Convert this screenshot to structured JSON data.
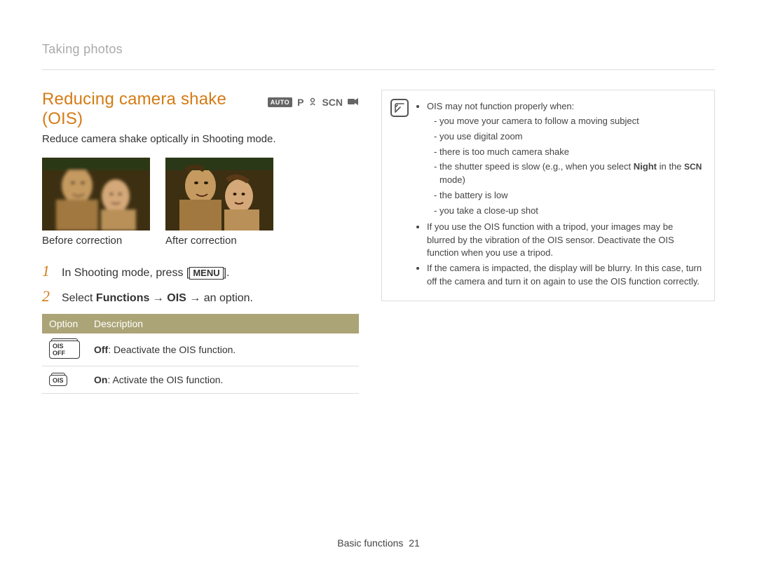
{
  "breadcrumb": "Taking photos",
  "heading": "Reducing camera shake (OIS)",
  "modes": {
    "auto": "AUTO",
    "p": "P",
    "scn": "SCN"
  },
  "intro": "Reduce camera shake optically in Shooting mode.",
  "compare": {
    "before": "Before correction",
    "after": "After correction"
  },
  "steps": [
    {
      "num": "1",
      "prefix": "In Shooting mode, press [",
      "button": "MENU",
      "suffix": "]."
    },
    {
      "num": "2",
      "prefix": "Select ",
      "bold1": "Functions",
      "arrow1": " → ",
      "bold2": "OIS",
      "arrow2": " → an option."
    }
  ],
  "table": {
    "headers": {
      "option": "Option",
      "desc": "Description"
    },
    "rows": [
      {
        "icon_text": "OIS OFF",
        "label": "Off",
        "desc": ": Deactivate the OIS function."
      },
      {
        "icon_text": "OIS",
        "label": "On",
        "desc": ": Activate the OIS function."
      }
    ]
  },
  "notes": {
    "intro": "OIS may not function properly when:",
    "sub": [
      "you move your camera to follow a moving subject",
      "you use digital zoom",
      "there is too much camera shake",
      "the shutter speed is slow (e.g., when you select ",
      "mode)",
      "the battery is low",
      "you take a close-up shot"
    ],
    "night_label": "Night",
    "scn_label": "SCN",
    "bullets": [
      "If you use the OIS function with a tripod, your images may be blurred by the vibration of the OIS sensor. Deactivate the OIS function when you use a tripod.",
      "If the camera is impacted, the display will be blurry. In this case, turn off the camera and turn it on again to use the OIS function correctly."
    ]
  },
  "footer": {
    "section": "Basic functions",
    "page": "21"
  }
}
